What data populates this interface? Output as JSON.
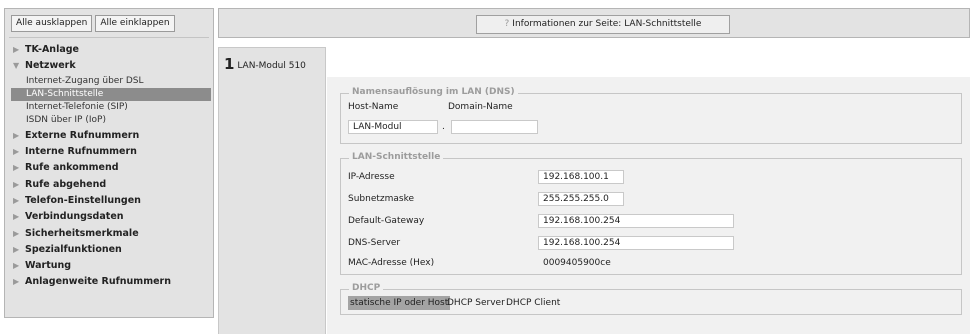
{
  "sidebar": {
    "expand_all": "Alle ausklappen",
    "collapse_all": "Alle einklappen",
    "items": [
      {
        "label": "TK-Anlage"
      },
      {
        "label": "Netzwerk",
        "children": [
          "Internet-Zugang über DSL",
          "LAN-Schnittstelle",
          "Internet-Telefonie (SIP)",
          "ISDN über IP (IoP)"
        ]
      },
      {
        "label": "Externe Rufnummern"
      },
      {
        "label": "Interne Rufnummern"
      },
      {
        "label": "Rufe ankommend"
      },
      {
        "label": "Rufe abgehend"
      },
      {
        "label": "Telefon-Einstellungen"
      },
      {
        "label": "Verbindungsdaten"
      },
      {
        "label": "Sicherheitsmerkmale"
      },
      {
        "label": "Spezialfunktionen"
      },
      {
        "label": "Wartung"
      },
      {
        "label": "Anlagenweite Rufnummern"
      }
    ],
    "active_child": "LAN-Schnittstelle"
  },
  "header": {
    "info_icon": "?",
    "info_label": "Informationen zur Seite: LAN-Schnittstelle"
  },
  "module": {
    "number": "1",
    "label": "LAN-Modul 510"
  },
  "dns": {
    "legend": "Namensauflösung im LAN (DNS)",
    "host_label": "Host-Name",
    "domain_label": "Domain-Name",
    "host_value": "LAN-Modul",
    "separator": ".",
    "domain_value": ""
  },
  "lan": {
    "legend": "LAN-Schnittstelle",
    "ip_label": "IP-Adresse",
    "ip_value": "192.168.100.1",
    "subnet_label": "Subnetzmaske",
    "subnet_value": "255.255.255.0",
    "gateway_label": "Default-Gateway",
    "gateway_value": "192.168.100.254",
    "dns_label": "DNS-Server",
    "dns_value": "192.168.100.254",
    "mac_label": "MAC-Adresse (Hex)",
    "mac_value": "0009405900ce"
  },
  "dhcp": {
    "legend": "DHCP",
    "options": [
      "statische IP oder Host",
      "DHCP Server",
      "DHCP Client"
    ],
    "selected": "statische IP oder Host"
  },
  "colors": {
    "panel_bg": "#e3e3e3",
    "content_bg": "#f1f1f1",
    "active_item_bg": "#8c8c8c",
    "legend_text": "#9c9c9c"
  }
}
